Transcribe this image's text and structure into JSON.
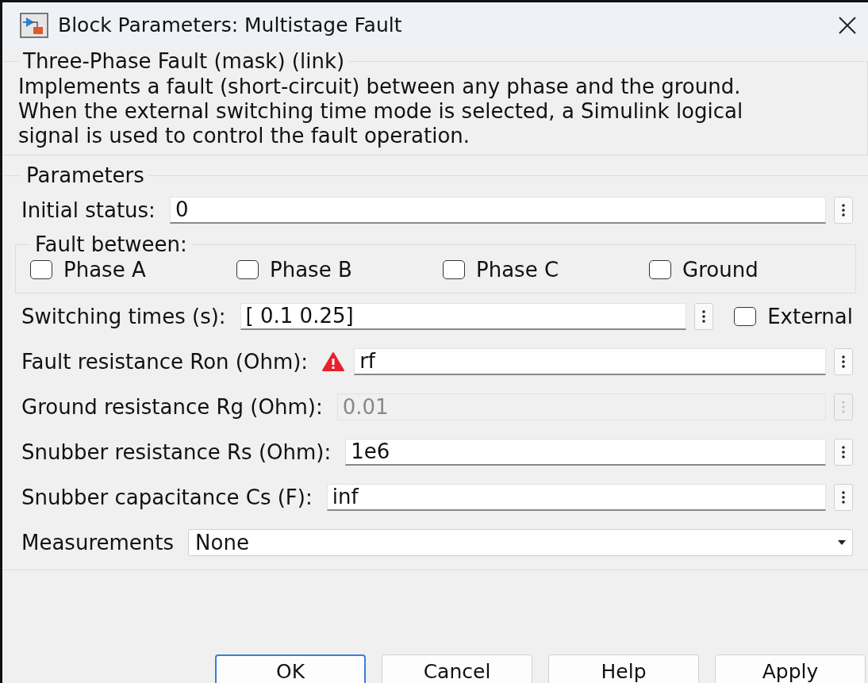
{
  "window": {
    "title": "Block Parameters: Multistage Fault"
  },
  "description": {
    "title": "Three-Phase Fault (mask) (link)",
    "text": "Implements a fault (short-circuit) between any phase and the ground. When the external switching time mode is selected, a Simulink logical signal is used to control the fault operation."
  },
  "parameters": {
    "title": "Parameters",
    "rows": [
      {
        "kind": "field",
        "label": "Initial status:",
        "value": "0",
        "warning": false,
        "disabled": false
      },
      {
        "kind": "checkgroup",
        "label": "Fault between:",
        "options": [
          {
            "label": "Phase A",
            "checked": false
          },
          {
            "label": "Phase B",
            "checked": false
          },
          {
            "label": "Phase C",
            "checked": false
          },
          {
            "label": "Ground",
            "checked": false
          }
        ]
      },
      {
        "kind": "field",
        "label": "Switching times (s):",
        "value": "[ 0.1 0.25]",
        "warning": false,
        "disabled": false,
        "external": {
          "label": "External",
          "checked": false
        }
      },
      {
        "kind": "field",
        "label": "Fault resistance Ron (Ohm):",
        "value": "rf",
        "warning": true,
        "disabled": false
      },
      {
        "kind": "field",
        "label": "Ground resistance Rg (Ohm):",
        "value": "0.01",
        "warning": false,
        "disabled": true
      },
      {
        "kind": "field",
        "label": "Snubber resistance Rs (Ohm):",
        "value": "1e6",
        "warning": false,
        "disabled": false
      },
      {
        "kind": "field",
        "label": "Snubber capacitance Cs (F):",
        "value": "inf",
        "warning": false,
        "disabled": false
      },
      {
        "kind": "dropdown",
        "label": "Measurements",
        "value": "None"
      }
    ]
  },
  "buttons": [
    {
      "label": "OK",
      "default": true
    },
    {
      "label": "Cancel",
      "default": false
    },
    {
      "label": "Help",
      "default": false
    },
    {
      "label": "Apply",
      "default": false
    }
  ]
}
